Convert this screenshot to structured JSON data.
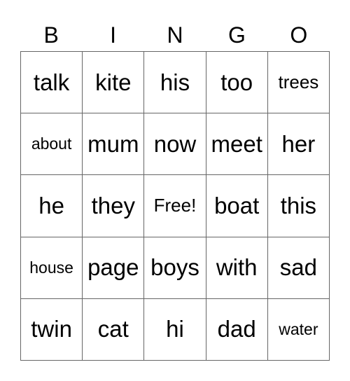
{
  "header": [
    "B",
    "I",
    "N",
    "G",
    "O"
  ],
  "cells": [
    [
      "talk",
      "kite",
      "his",
      "too",
      "trees"
    ],
    [
      "about",
      "mum",
      "now",
      "meet",
      "her"
    ],
    [
      "he",
      "they",
      "Free!",
      "boat",
      "this"
    ],
    [
      "house",
      "page",
      "boys",
      "with",
      "sad"
    ],
    [
      "twin",
      "cat",
      "hi",
      "dad",
      "water"
    ]
  ]
}
